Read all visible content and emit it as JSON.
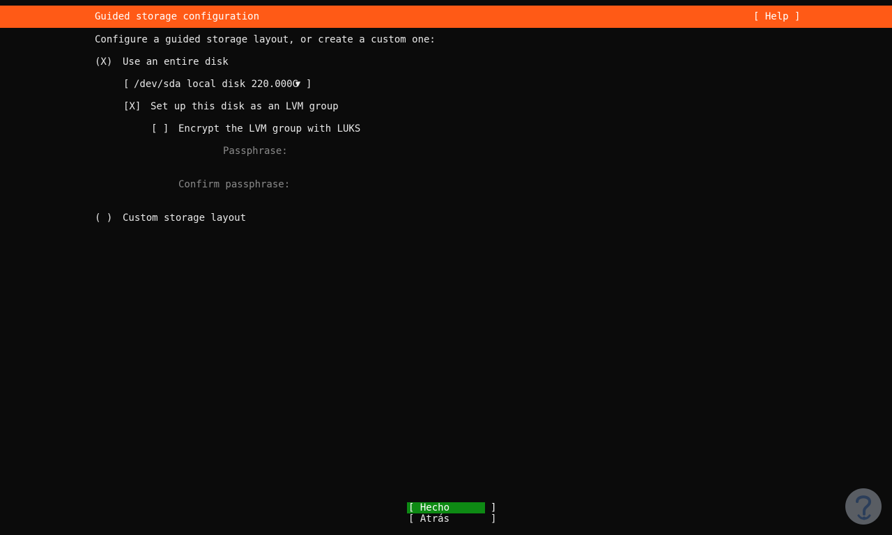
{
  "header": {
    "title": "Guided storage configuration",
    "help": "[ Help ]"
  },
  "intro": "Configure a guided storage layout, or create a custom one:",
  "options": {
    "entire_disk": {
      "marker": "(X)",
      "label": "Use an entire disk",
      "selected": true
    },
    "custom": {
      "marker": "( )",
      "label": "Custom storage layout",
      "selected": false
    }
  },
  "disk_select": {
    "open": "[",
    "value": "/dev/sda local disk 220.000G",
    "arrow": "▼",
    "close": "]"
  },
  "lvm": {
    "marker": "[X]",
    "label": "Set up this disk as an LVM group",
    "checked": true
  },
  "luks": {
    "marker": "[ ]",
    "label": "Encrypt the LVM group with LUKS",
    "checked": false
  },
  "passphrase": {
    "label": "Passphrase:",
    "value": ""
  },
  "confirm_passphrase": {
    "label": "Confirm passphrase:",
    "value": ""
  },
  "buttons": {
    "done": "[ Hecho       ]",
    "back": "[ Atrás       ]"
  },
  "colors": {
    "header_bg": "#ff5a16",
    "focus_bg": "#0e8a14",
    "background": "#0b0b0b",
    "disabled_text": "#8a8a8a"
  },
  "watermark": {
    "icon": "help-logo-icon"
  }
}
